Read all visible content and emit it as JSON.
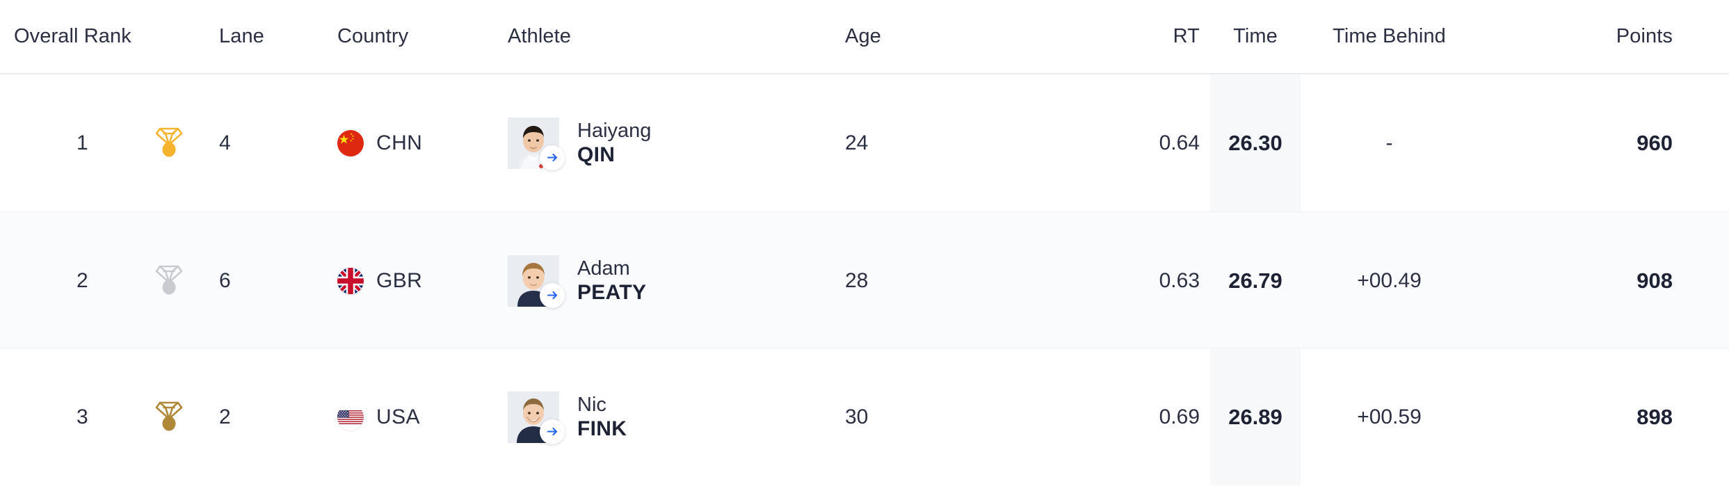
{
  "table": {
    "columns": [
      {
        "key": "overall_rank",
        "label": "Overall Rank"
      },
      {
        "key": "medal",
        "label": ""
      },
      {
        "key": "lane",
        "label": "Lane"
      },
      {
        "key": "country",
        "label": "Country"
      },
      {
        "key": "athlete",
        "label": "Athlete"
      },
      {
        "key": "age",
        "label": "Age"
      },
      {
        "key": "rt",
        "label": "RT"
      },
      {
        "key": "time",
        "label": "Time"
      },
      {
        "key": "time_behind",
        "label": "Time Behind"
      },
      {
        "key": "points",
        "label": "Points"
      }
    ],
    "headers": {
      "overall_rank": "Overall Rank",
      "lane": "Lane",
      "country": "Country",
      "athlete": "Athlete",
      "age": "Age",
      "rt": "RT",
      "time": "Time",
      "time_behind": "Time Behind",
      "points": "Points"
    },
    "rows": [
      {
        "overall_rank": "1",
        "medal": "gold-medal-icon",
        "medal_color": "#F5B32E",
        "lane": "4",
        "country_code": "CHN",
        "country_flag": "flag-china-icon",
        "athlete_first": "Haiyang",
        "athlete_last": "QIN",
        "athlete_link": "arrow-right-icon",
        "age": "24",
        "rt": "0.64",
        "time": "26.30",
        "time_behind": "-",
        "points": "960"
      },
      {
        "overall_rank": "2",
        "medal": "silver-medal-icon",
        "medal_color": "#C8CBD0",
        "lane": "6",
        "country_code": "GBR",
        "country_flag": "flag-great-britain-icon",
        "athlete_first": "Adam",
        "athlete_last": "PEATY",
        "athlete_link": "arrow-right-icon",
        "age": "28",
        "rt": "0.63",
        "time": "26.79",
        "time_behind": "+00.49",
        "points": "908"
      },
      {
        "overall_rank": "3",
        "medal": "bronze-medal-icon",
        "medal_color": "#B08938",
        "lane": "2",
        "country_code": "USA",
        "country_flag": "flag-usa-icon",
        "athlete_first": "Nic",
        "athlete_last": "FINK",
        "athlete_link": "arrow-right-icon",
        "age": "30",
        "rt": "0.69",
        "time": "26.89",
        "time_behind": "+00.59",
        "points": "898"
      }
    ]
  },
  "colors": {
    "text_primary": "#2b2f42",
    "text_strong": "#1d2235",
    "row_alt_bg": "#fafbfd",
    "time_highlight_bg": "#f7f8fa",
    "divider": "#e9ebef",
    "link_accent": "#2563EB"
  }
}
